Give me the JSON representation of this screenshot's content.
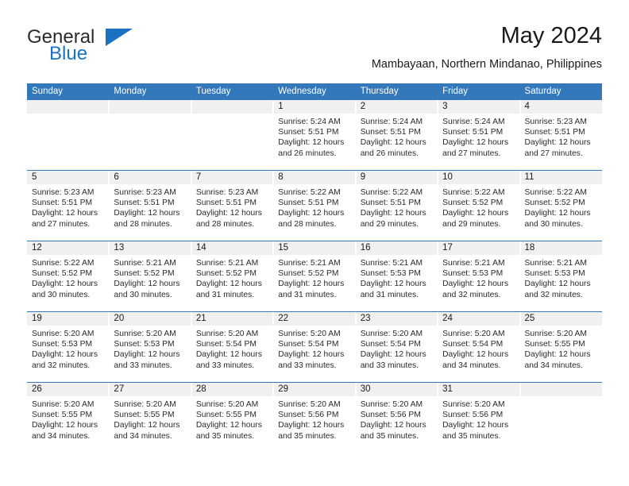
{
  "brand": {
    "name_top": "General",
    "name_bottom": "Blue",
    "triangle_icon": "triangle-icon",
    "color_blue": "#1b72c2",
    "color_dark": "#2b2b2b"
  },
  "header": {
    "title": "May 2024",
    "subtitle": "Mambayaan, Northern Mindanao, Philippines"
  },
  "theme": {
    "header_bg": "#3478bc",
    "header_text": "#ffffff",
    "daynum_bg": "#f0f0f0",
    "cell_bg": "#ffffff",
    "rule": "#3478bc"
  },
  "weekdays": [
    "Sunday",
    "Monday",
    "Tuesday",
    "Wednesday",
    "Thursday",
    "Friday",
    "Saturday"
  ],
  "weeks": [
    [
      {
        "day": "",
        "lines": []
      },
      {
        "day": "",
        "lines": []
      },
      {
        "day": "",
        "lines": []
      },
      {
        "day": "1",
        "lines": [
          "Sunrise: 5:24 AM",
          "Sunset: 5:51 PM",
          "Daylight: 12 hours",
          "and 26 minutes."
        ]
      },
      {
        "day": "2",
        "lines": [
          "Sunrise: 5:24 AM",
          "Sunset: 5:51 PM",
          "Daylight: 12 hours",
          "and 26 minutes."
        ]
      },
      {
        "day": "3",
        "lines": [
          "Sunrise: 5:24 AM",
          "Sunset: 5:51 PM",
          "Daylight: 12 hours",
          "and 27 minutes."
        ]
      },
      {
        "day": "4",
        "lines": [
          "Sunrise: 5:23 AM",
          "Sunset: 5:51 PM",
          "Daylight: 12 hours",
          "and 27 minutes."
        ]
      }
    ],
    [
      {
        "day": "5",
        "lines": [
          "Sunrise: 5:23 AM",
          "Sunset: 5:51 PM",
          "Daylight: 12 hours",
          "and 27 minutes."
        ]
      },
      {
        "day": "6",
        "lines": [
          "Sunrise: 5:23 AM",
          "Sunset: 5:51 PM",
          "Daylight: 12 hours",
          "and 28 minutes."
        ]
      },
      {
        "day": "7",
        "lines": [
          "Sunrise: 5:23 AM",
          "Sunset: 5:51 PM",
          "Daylight: 12 hours",
          "and 28 minutes."
        ]
      },
      {
        "day": "8",
        "lines": [
          "Sunrise: 5:22 AM",
          "Sunset: 5:51 PM",
          "Daylight: 12 hours",
          "and 28 minutes."
        ]
      },
      {
        "day": "9",
        "lines": [
          "Sunrise: 5:22 AM",
          "Sunset: 5:51 PM",
          "Daylight: 12 hours",
          "and 29 minutes."
        ]
      },
      {
        "day": "10",
        "lines": [
          "Sunrise: 5:22 AM",
          "Sunset: 5:52 PM",
          "Daylight: 12 hours",
          "and 29 minutes."
        ]
      },
      {
        "day": "11",
        "lines": [
          "Sunrise: 5:22 AM",
          "Sunset: 5:52 PM",
          "Daylight: 12 hours",
          "and 30 minutes."
        ]
      }
    ],
    [
      {
        "day": "12",
        "lines": [
          "Sunrise: 5:22 AM",
          "Sunset: 5:52 PM",
          "Daylight: 12 hours",
          "and 30 minutes."
        ]
      },
      {
        "day": "13",
        "lines": [
          "Sunrise: 5:21 AM",
          "Sunset: 5:52 PM",
          "Daylight: 12 hours",
          "and 30 minutes."
        ]
      },
      {
        "day": "14",
        "lines": [
          "Sunrise: 5:21 AM",
          "Sunset: 5:52 PM",
          "Daylight: 12 hours",
          "and 31 minutes."
        ]
      },
      {
        "day": "15",
        "lines": [
          "Sunrise: 5:21 AM",
          "Sunset: 5:52 PM",
          "Daylight: 12 hours",
          "and 31 minutes."
        ]
      },
      {
        "day": "16",
        "lines": [
          "Sunrise: 5:21 AM",
          "Sunset: 5:53 PM",
          "Daylight: 12 hours",
          "and 31 minutes."
        ]
      },
      {
        "day": "17",
        "lines": [
          "Sunrise: 5:21 AM",
          "Sunset: 5:53 PM",
          "Daylight: 12 hours",
          "and 32 minutes."
        ]
      },
      {
        "day": "18",
        "lines": [
          "Sunrise: 5:21 AM",
          "Sunset: 5:53 PM",
          "Daylight: 12 hours",
          "and 32 minutes."
        ]
      }
    ],
    [
      {
        "day": "19",
        "lines": [
          "Sunrise: 5:20 AM",
          "Sunset: 5:53 PM",
          "Daylight: 12 hours",
          "and 32 minutes."
        ]
      },
      {
        "day": "20",
        "lines": [
          "Sunrise: 5:20 AM",
          "Sunset: 5:53 PM",
          "Daylight: 12 hours",
          "and 33 minutes."
        ]
      },
      {
        "day": "21",
        "lines": [
          "Sunrise: 5:20 AM",
          "Sunset: 5:54 PM",
          "Daylight: 12 hours",
          "and 33 minutes."
        ]
      },
      {
        "day": "22",
        "lines": [
          "Sunrise: 5:20 AM",
          "Sunset: 5:54 PM",
          "Daylight: 12 hours",
          "and 33 minutes."
        ]
      },
      {
        "day": "23",
        "lines": [
          "Sunrise: 5:20 AM",
          "Sunset: 5:54 PM",
          "Daylight: 12 hours",
          "and 33 minutes."
        ]
      },
      {
        "day": "24",
        "lines": [
          "Sunrise: 5:20 AM",
          "Sunset: 5:54 PM",
          "Daylight: 12 hours",
          "and 34 minutes."
        ]
      },
      {
        "day": "25",
        "lines": [
          "Sunrise: 5:20 AM",
          "Sunset: 5:55 PM",
          "Daylight: 12 hours",
          "and 34 minutes."
        ]
      }
    ],
    [
      {
        "day": "26",
        "lines": [
          "Sunrise: 5:20 AM",
          "Sunset: 5:55 PM",
          "Daylight: 12 hours",
          "and 34 minutes."
        ]
      },
      {
        "day": "27",
        "lines": [
          "Sunrise: 5:20 AM",
          "Sunset: 5:55 PM",
          "Daylight: 12 hours",
          "and 34 minutes."
        ]
      },
      {
        "day": "28",
        "lines": [
          "Sunrise: 5:20 AM",
          "Sunset: 5:55 PM",
          "Daylight: 12 hours",
          "and 35 minutes."
        ]
      },
      {
        "day": "29",
        "lines": [
          "Sunrise: 5:20 AM",
          "Sunset: 5:56 PM",
          "Daylight: 12 hours",
          "and 35 minutes."
        ]
      },
      {
        "day": "30",
        "lines": [
          "Sunrise: 5:20 AM",
          "Sunset: 5:56 PM",
          "Daylight: 12 hours",
          "and 35 minutes."
        ]
      },
      {
        "day": "31",
        "lines": [
          "Sunrise: 5:20 AM",
          "Sunset: 5:56 PM",
          "Daylight: 12 hours",
          "and 35 minutes."
        ]
      },
      {
        "day": "",
        "lines": []
      }
    ]
  ]
}
